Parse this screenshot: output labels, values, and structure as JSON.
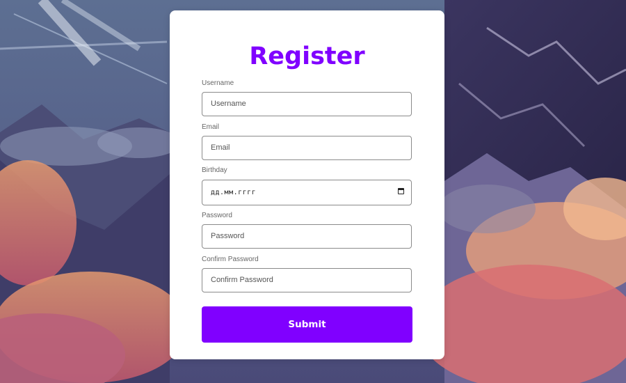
{
  "form": {
    "title": "Register",
    "fields": [
      {
        "label": "Username",
        "placeholder": "Username",
        "type": "text"
      },
      {
        "label": "Email",
        "placeholder": "Email",
        "type": "email"
      },
      {
        "label": "Birthday",
        "placeholder": "дд.мм.гггг",
        "type": "date"
      },
      {
        "label": "Password",
        "placeholder": "Password",
        "type": "password"
      },
      {
        "label": "Confirm Password",
        "placeholder": "Confirm Password",
        "type": "password"
      }
    ],
    "submit_label": "Submit"
  },
  "colors": {
    "accent": "#8000ff",
    "card_background": "#ffffff",
    "input_border": "#8a8a8a",
    "label_text": "#666666"
  },
  "icons": {
    "birthday_picker": "calendar-icon"
  }
}
